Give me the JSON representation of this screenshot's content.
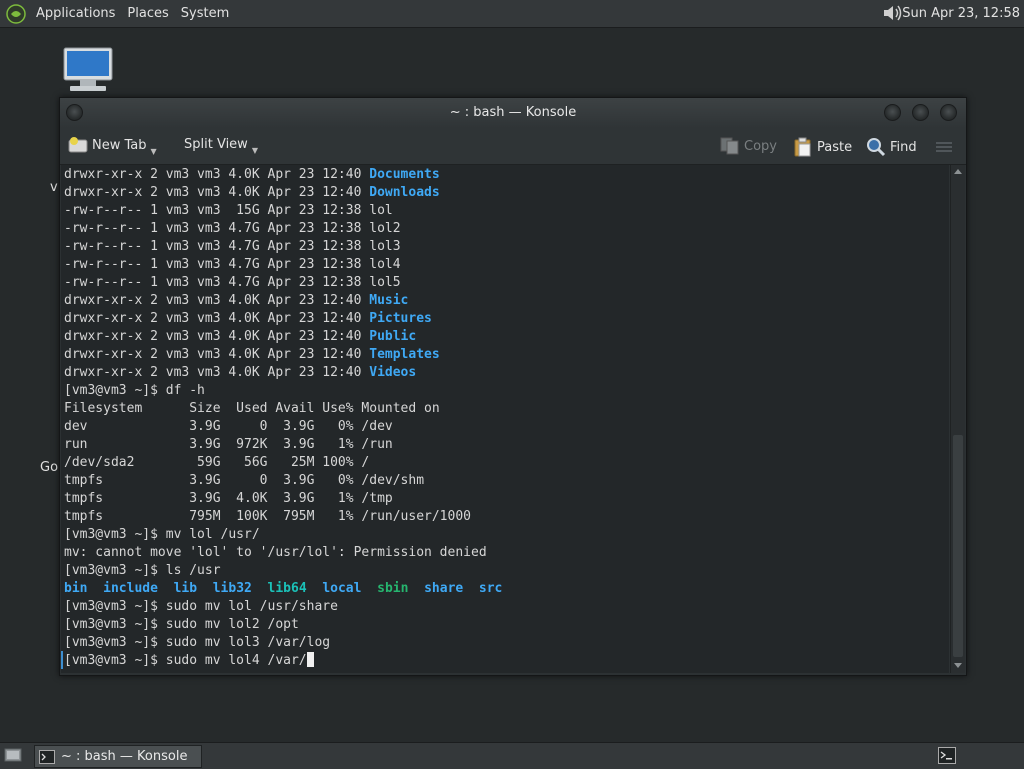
{
  "top_panel": {
    "menus": [
      "Applications",
      "Places",
      "System"
    ],
    "clock": "Sun Apr 23, 12:58"
  },
  "desktop": {
    "labels": [
      "v",
      "Go"
    ]
  },
  "window": {
    "title": "~ : bash — Konsole",
    "toolbar": {
      "new_tab": "New Tab",
      "split_view": "Split View",
      "copy": "Copy",
      "paste": "Paste",
      "find": "Find"
    }
  },
  "terminal": {
    "lines": [
      [
        {
          "t": "drwxr-xr-x 2 vm3 vm3 4.0K Apr 23 12:40 "
        },
        {
          "t": "Documents",
          "c": "dir"
        }
      ],
      [
        {
          "t": "drwxr-xr-x 2 vm3 vm3 4.0K Apr 23 12:40 "
        },
        {
          "t": "Downloads",
          "c": "dir"
        }
      ],
      [
        {
          "t": "-rw-r--r-- 1 vm3 vm3  15G Apr 23 12:38 lol"
        }
      ],
      [
        {
          "t": "-rw-r--r-- 1 vm3 vm3 4.7G Apr 23 12:38 lol2"
        }
      ],
      [
        {
          "t": "-rw-r--r-- 1 vm3 vm3 4.7G Apr 23 12:38 lol3"
        }
      ],
      [
        {
          "t": "-rw-r--r-- 1 vm3 vm3 4.7G Apr 23 12:38 lol4"
        }
      ],
      [
        {
          "t": "-rw-r--r-- 1 vm3 vm3 4.7G Apr 23 12:38 lol5"
        }
      ],
      [
        {
          "t": "drwxr-xr-x 2 vm3 vm3 4.0K Apr 23 12:40 "
        },
        {
          "t": "Music",
          "c": "dir"
        }
      ],
      [
        {
          "t": "drwxr-xr-x 2 vm3 vm3 4.0K Apr 23 12:40 "
        },
        {
          "t": "Pictures",
          "c": "dir"
        }
      ],
      [
        {
          "t": "drwxr-xr-x 2 vm3 vm3 4.0K Apr 23 12:40 "
        },
        {
          "t": "Public",
          "c": "dir"
        }
      ],
      [
        {
          "t": "drwxr-xr-x 2 vm3 vm3 4.0K Apr 23 12:40 "
        },
        {
          "t": "Templates",
          "c": "dir"
        }
      ],
      [
        {
          "t": "drwxr-xr-x 2 vm3 vm3 4.0K Apr 23 12:40 "
        },
        {
          "t": "Videos",
          "c": "dir"
        }
      ],
      [
        {
          "t": "[vm3@vm3 ~]$ df -h"
        }
      ],
      [
        {
          "t": "Filesystem      Size  Used Avail Use% Mounted on"
        }
      ],
      [
        {
          "t": "dev             3.9G     0  3.9G   0% /dev"
        }
      ],
      [
        {
          "t": "run             3.9G  972K  3.9G   1% /run"
        }
      ],
      [
        {
          "t": "/dev/sda2        59G   56G   25M 100% /"
        }
      ],
      [
        {
          "t": "tmpfs           3.9G     0  3.9G   0% /dev/shm"
        }
      ],
      [
        {
          "t": "tmpfs           3.9G  4.0K  3.9G   1% /tmp"
        }
      ],
      [
        {
          "t": "tmpfs           795M  100K  795M   1% /run/user/1000"
        }
      ],
      [
        {
          "t": "[vm3@vm3 ~]$ mv lol /usr/"
        }
      ],
      [
        {
          "t": "mv: cannot move 'lol' to '/usr/lol': Permission denied"
        }
      ],
      [
        {
          "t": "[vm3@vm3 ~]$ ls /usr"
        }
      ],
      [
        {
          "t": "bin",
          "c": "dir"
        },
        {
          "t": "  "
        },
        {
          "t": "include",
          "c": "dir"
        },
        {
          "t": "  "
        },
        {
          "t": "lib",
          "c": "dir"
        },
        {
          "t": "  "
        },
        {
          "t": "lib32",
          "c": "dir"
        },
        {
          "t": "  "
        },
        {
          "t": "lib64",
          "c": "link"
        },
        {
          "t": "  "
        },
        {
          "t": "local",
          "c": "dir"
        },
        {
          "t": "  "
        },
        {
          "t": "sbin",
          "c": "exe"
        },
        {
          "t": "  "
        },
        {
          "t": "share",
          "c": "dir"
        },
        {
          "t": "  "
        },
        {
          "t": "src",
          "c": "dir"
        }
      ],
      [
        {
          "t": "[vm3@vm3 ~]$ sudo mv lol /usr/share"
        }
      ],
      [
        {
          "t": "[vm3@vm3 ~]$ sudo mv lol2 /opt"
        }
      ],
      [
        {
          "t": "[vm3@vm3 ~]$ sudo mv lol3 /var/log"
        }
      ],
      [
        {
          "t": "[vm3@vm3 ~]$ sudo mv lol4 /var/"
        }
      ]
    ]
  },
  "taskbar": {
    "konsole_label": "~ : bash — Konsole"
  },
  "colors": {
    "directory": "#3fa9f5",
    "symlink": "#1bc1b8",
    "executable": "#26b56f"
  },
  "icons": [
    "mate-logo-icon",
    "volume-icon",
    "computer-icon",
    "konsole-icon",
    "show-desktop-icon",
    "terminal-icon",
    "new-tab-icon",
    "copy-icon",
    "paste-icon",
    "find-icon",
    "menu-icon"
  ]
}
